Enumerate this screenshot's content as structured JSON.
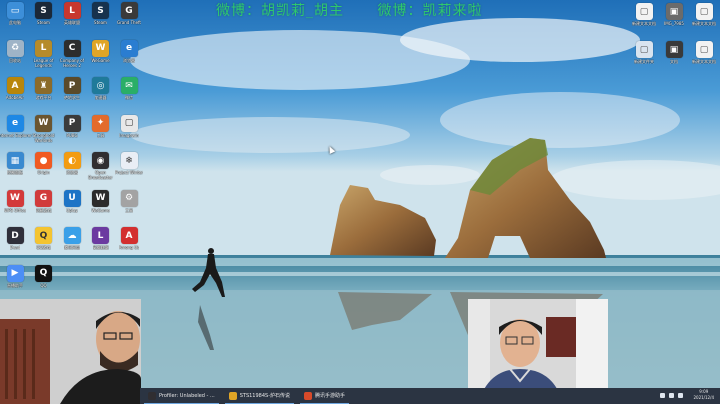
{
  "overlay": {
    "line1": "微博：胡凯莉_胡主",
    "line2": "微博：凯莉来啦"
  },
  "left_icons": [
    {
      "label": "此电脑",
      "icon": "computer-icon",
      "color": "#3d8fd9",
      "glyph": "▭"
    },
    {
      "label": "Steam",
      "icon": "steam-icon",
      "color": "#1b2838",
      "glyph": "S"
    },
    {
      "label": "英雄联盟",
      "icon": "game-icon",
      "color": "#c8372d",
      "glyph": "L"
    },
    {
      "label": "Steam",
      "icon": "steam-icon",
      "color": "#17324d",
      "glyph": "S"
    },
    {
      "label": "Grand Theft",
      "icon": "game-icon",
      "color": "#3a3a3a",
      "glyph": "G"
    },
    {
      "label": "回收站",
      "icon": "recycle-bin-icon",
      "color": "#9fb4c7",
      "glyph": "♻"
    },
    {
      "label": "League of Legends",
      "icon": "game-icon",
      "color": "#b58b2a",
      "glyph": "L"
    },
    {
      "label": "Company of Heroes 2",
      "icon": "game-icon",
      "color": "#2d2d2d",
      "glyph": "C"
    },
    {
      "label": "WeGame",
      "icon": "wegame-icon",
      "color": "#e0a526",
      "glyph": "W"
    },
    {
      "label": "浏览器",
      "icon": "browser-icon",
      "color": "#2a7dd1",
      "glyph": "e"
    },
    {
      "label": "AdobeAir",
      "icon": "app-icon",
      "color": "#b8860b",
      "glyph": "A"
    },
    {
      "label": "游戏平台",
      "icon": "game-icon",
      "color": "#8b6b2a",
      "glyph": "♜"
    },
    {
      "label": "绝地求生",
      "icon": "game-icon",
      "color": "#5a4a2a",
      "glyph": "P"
    },
    {
      "label": "加速器",
      "icon": "app-icon",
      "color": "#1f7a9a",
      "glyph": "◎"
    },
    {
      "label": "微信",
      "icon": "wechat-icon",
      "color": "#2aae67",
      "glyph": "✉"
    },
    {
      "label": "Internet Explorer",
      "icon": "ie-icon",
      "color": "#1e88e5",
      "glyph": "e"
    },
    {
      "label": "Stronghold Warlords",
      "icon": "game-icon",
      "color": "#6b5530",
      "glyph": "W"
    },
    {
      "label": "PUBG",
      "icon": "game-icon",
      "color": "#3b3b3b",
      "glyph": "P"
    },
    {
      "label": "工具",
      "icon": "app-icon",
      "color": "#e36b2b",
      "glyph": "✦"
    },
    {
      "label": "Imagewin",
      "icon": "file-icon",
      "color": "#e8e8e8",
      "glyph": "▢"
    },
    {
      "label": "控制面板",
      "icon": "control-panel-icon",
      "color": "#3a8ad0",
      "glyph": "▦"
    },
    {
      "label": "Origin",
      "icon": "origin-icon",
      "color": "#f05a22",
      "glyph": "●"
    },
    {
      "label": "浏览器",
      "icon": "browser-icon",
      "color": "#f39c12",
      "glyph": "◐"
    },
    {
      "label": "Open Broadcaster",
      "icon": "obs-icon",
      "color": "#302e31",
      "glyph": "◉"
    },
    {
      "label": "Project Winter",
      "icon": "game-icon",
      "color": "#e9eef5",
      "glyph": "❄"
    },
    {
      "label": "WPS Office",
      "icon": "wps-icon",
      "color": "#d33a3a",
      "glyph": "W"
    },
    {
      "label": "网易游戏",
      "icon": "game-icon",
      "color": "#d13b3b",
      "glyph": "G"
    },
    {
      "label": "Uplay",
      "icon": "uplay-icon",
      "color": "#1d74c6",
      "glyph": "U"
    },
    {
      "label": "WeGame",
      "icon": "wegame-icon",
      "color": "#2b2b2b",
      "glyph": "W"
    },
    {
      "label": "工具",
      "icon": "tool-icon",
      "color": "#a3a3a3",
      "glyph": "⚙"
    },
    {
      "label": "Dead",
      "icon": "game-icon",
      "color": "#2f2f3a",
      "glyph": "D"
    },
    {
      "label": "QQ游戏",
      "icon": "qq-game-icon",
      "color": "#f4c430",
      "glyph": "Q"
    },
    {
      "label": "腾讯网盘",
      "icon": "cloud-icon",
      "color": "#3aa0e8",
      "glyph": "☁"
    },
    {
      "label": "英雄联盟",
      "icon": "game-icon",
      "color": "#6b3aa0",
      "glyph": "L"
    },
    {
      "label": "Among Us",
      "icon": "game-icon",
      "color": "#d32f2f",
      "glyph": "A"
    },
    {
      "label": "直播助手",
      "icon": "app-icon",
      "color": "#4c8ef5",
      "glyph": "▶"
    },
    {
      "label": "QQ",
      "icon": "qq-icon",
      "color": "#111111",
      "glyph": "Q"
    }
  ],
  "right_icons": [
    {
      "label": "新建文本文档",
      "icon": "file-icon",
      "color": "#f2f2f2",
      "glyph": "▢"
    },
    {
      "label": "IMG_7985",
      "icon": "image-icon",
      "color": "#6b6b6b",
      "glyph": "▣"
    },
    {
      "label": "新建文本文档",
      "icon": "file-icon",
      "color": "#f2f2f2",
      "glyph": "▢"
    },
    {
      "label": "新建文件夹",
      "icon": "file-icon",
      "color": "#d9e4ef",
      "glyph": "▢"
    },
    {
      "label": "文档",
      "icon": "file-icon",
      "color": "#3a3a3a",
      "glyph": "▣"
    },
    {
      "label": "新建文本文档",
      "icon": "file-icon",
      "color": "#f2f2f2",
      "glyph": "▢"
    }
  ],
  "taskbar": {
    "tasks": [
      {
        "label": "Profiler: Unlabeled - ...",
        "icon": "obs-icon",
        "color": "#302e31"
      },
      {
        "label": "STS11984S-炉石传说",
        "icon": "game-icon",
        "color": "#e0a526"
      },
      {
        "label": "腾讯手游助手",
        "icon": "app-icon",
        "color": "#d84a2a"
      }
    ],
    "time": "9:09",
    "date": "2021/12/4"
  }
}
